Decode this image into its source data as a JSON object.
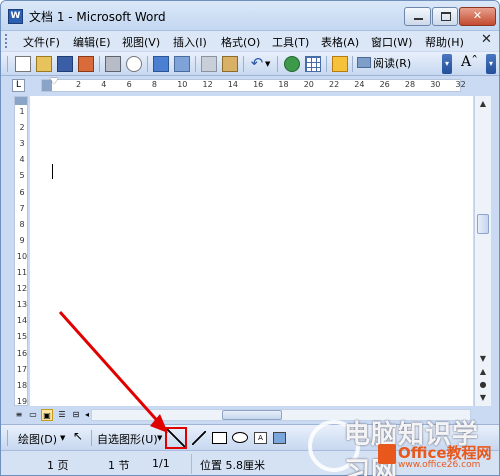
{
  "window": {
    "title": "文档 1 - Microsoft Word",
    "app_icon": "W",
    "close_glyph": "✕"
  },
  "menubar": {
    "items": [
      "文件(F)",
      "编辑(E)",
      "视图(V)",
      "插入(I)",
      "格式(O)",
      "工具(T)",
      "表格(A)",
      "窗口(W)",
      "帮助(H)"
    ],
    "doc_close": "✕"
  },
  "toolbar": {
    "read_label": "阅读(R)",
    "font_size_glyph": "Aˆ"
  },
  "ruler": {
    "h_ticks": [
      "2",
      "4",
      "6",
      "8",
      "10",
      "12",
      "14",
      "16",
      "18",
      "20",
      "22",
      "24",
      "26",
      "28",
      "30",
      "32"
    ],
    "v_ticks": [
      "1",
      "2",
      "3",
      "4",
      "5",
      "6",
      "7",
      "8",
      "9",
      "10",
      "11",
      "12",
      "13",
      "14",
      "15",
      "16",
      "17",
      "18",
      "19"
    ],
    "tab_selector": "L"
  },
  "drawing_toolbar": {
    "draw_label": "绘图(D)",
    "autoshapes_label": "自选图形(U)",
    "textbox_glyph": "A"
  },
  "statusbar": {
    "page": "1 页",
    "section": "1 节",
    "page_of": "1/1",
    "position": "位置 5.8厘米"
  },
  "watermark": {
    "cn_text": "电脑知识学习网",
    "brand": "Office教程网",
    "url": "www.office26.com"
  },
  "annotation": {
    "color": "#e00000"
  }
}
